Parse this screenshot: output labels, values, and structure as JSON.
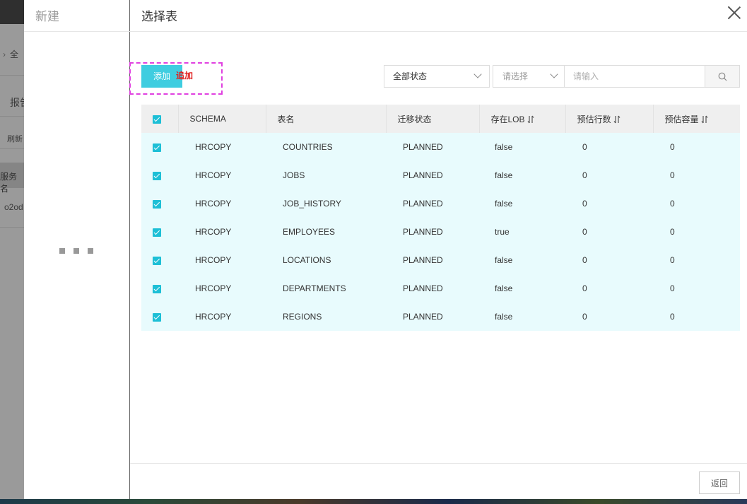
{
  "background": {
    "sidebar_fragments": [
      "全",
      "报告",
      "刷新",
      "服务名",
      "o2od"
    ]
  },
  "new_drawer": {
    "title": "新建"
  },
  "panel": {
    "title": "选择表",
    "add_button": "添加",
    "add_annotation": "追加",
    "status_select": "全部状态",
    "search_type_placeholder": "请选择",
    "search_input_placeholder": "请输入",
    "back_button": "返回"
  },
  "table": {
    "columns": [
      "SCHEMA",
      "表名",
      "迁移状态",
      "存在LOB",
      "预估行数",
      "预估容量"
    ],
    "rows": [
      [
        "HRCOPY",
        "COUNTRIES",
        "PLANNED",
        "false",
        "0",
        "0"
      ],
      [
        "HRCOPY",
        "JOBS",
        "PLANNED",
        "false",
        "0",
        "0"
      ],
      [
        "HRCOPY",
        "JOB_HISTORY",
        "PLANNED",
        "false",
        "0",
        "0"
      ],
      [
        "HRCOPY",
        "EMPLOYEES",
        "PLANNED",
        "true",
        "0",
        "0"
      ],
      [
        "HRCOPY",
        "LOCATIONS",
        "PLANNED",
        "false",
        "0",
        "0"
      ],
      [
        "HRCOPY",
        "DEPARTMENTS",
        "PLANNED",
        "false",
        "0",
        "0"
      ],
      [
        "HRCOPY",
        "REGIONS",
        "PLANNED",
        "false",
        "0",
        "0"
      ]
    ]
  },
  "colors": {
    "accent": "#3fcde0",
    "checkbox": "#1dbfd6",
    "row_bg": "#e8fbfd",
    "annotation": "#e02020",
    "highlight_border": "#e040e0"
  }
}
